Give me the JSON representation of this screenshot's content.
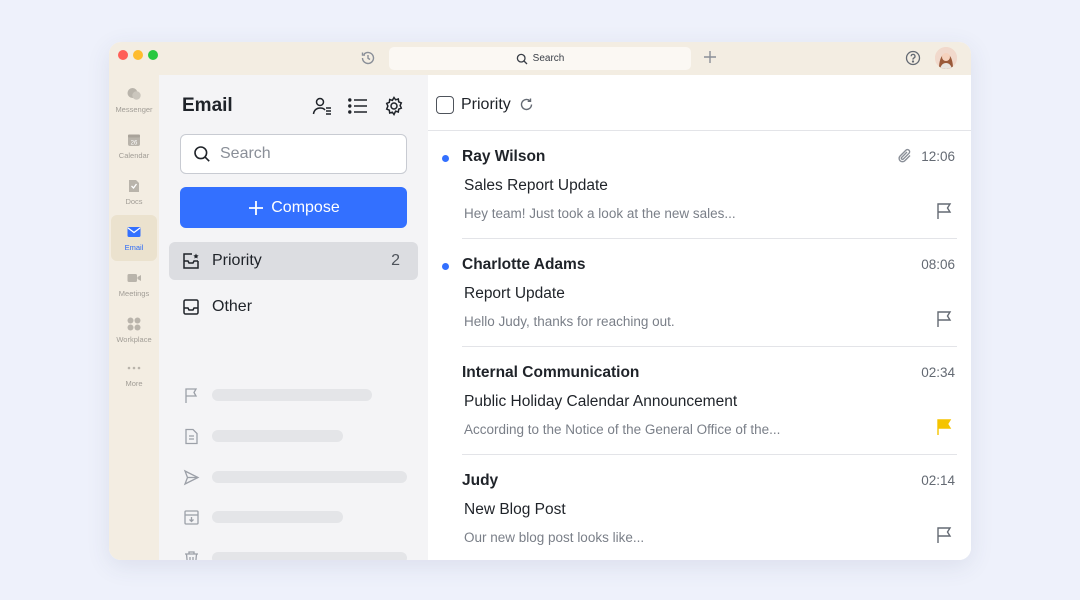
{
  "titlebar": {
    "search_label": "Search"
  },
  "rail": {
    "items": [
      {
        "label": "Messenger",
        "icon": "messenger-icon"
      },
      {
        "label": "Calendar",
        "icon": "calendar-icon",
        "badge": "26"
      },
      {
        "label": "Docs",
        "icon": "docs-icon"
      },
      {
        "label": "Email",
        "icon": "email-icon",
        "active": true
      },
      {
        "label": "Meetings",
        "icon": "video-icon"
      },
      {
        "label": "Workplace",
        "icon": "apps-grid-icon"
      },
      {
        "label": "More",
        "icon": "more-dots-icon"
      }
    ]
  },
  "sidebar": {
    "title": "Email",
    "search_placeholder": "Search",
    "compose_label": "Compose",
    "folders": [
      {
        "label": "Priority",
        "count": "2",
        "icon": "priority-inbox-icon",
        "active": true
      },
      {
        "label": "Other",
        "count": "",
        "icon": "inbox-icon"
      }
    ],
    "placeholder_icons": [
      "flag-icon",
      "document-icon",
      "send-icon",
      "archive-icon",
      "trash-icon",
      "clock-icon"
    ]
  },
  "main": {
    "header_title": "Priority",
    "emails": [
      {
        "sender": "Ray Wilson",
        "time": "12:06",
        "subject": "Sales Report Update",
        "preview": "Hey team! Just took a look at the new sales...",
        "unread": true,
        "attachment": true,
        "flagged": false
      },
      {
        "sender": "Charlotte Adams",
        "time": "08:06",
        "subject": "Report Update",
        "preview": "Hello Judy, thanks for reaching out.",
        "unread": true,
        "attachment": false,
        "flagged": false
      },
      {
        "sender": "Internal Communication",
        "time": "02:34",
        "subject": "Public Holiday Calendar Announcement",
        "preview": "According to the Notice of the General Office of the...",
        "unread": false,
        "attachment": false,
        "flagged": true
      },
      {
        "sender": "Judy",
        "time": "02:14",
        "subject": "New Blog Post",
        "preview": "Our new blog post looks like...",
        "unread": false,
        "attachment": false,
        "flagged": false
      }
    ]
  },
  "colors": {
    "accent": "#3370ff",
    "flag_active": "#f5c400",
    "titlebar_bg": "#f3ede2",
    "sidebar_bg": "#f4f4f6"
  }
}
